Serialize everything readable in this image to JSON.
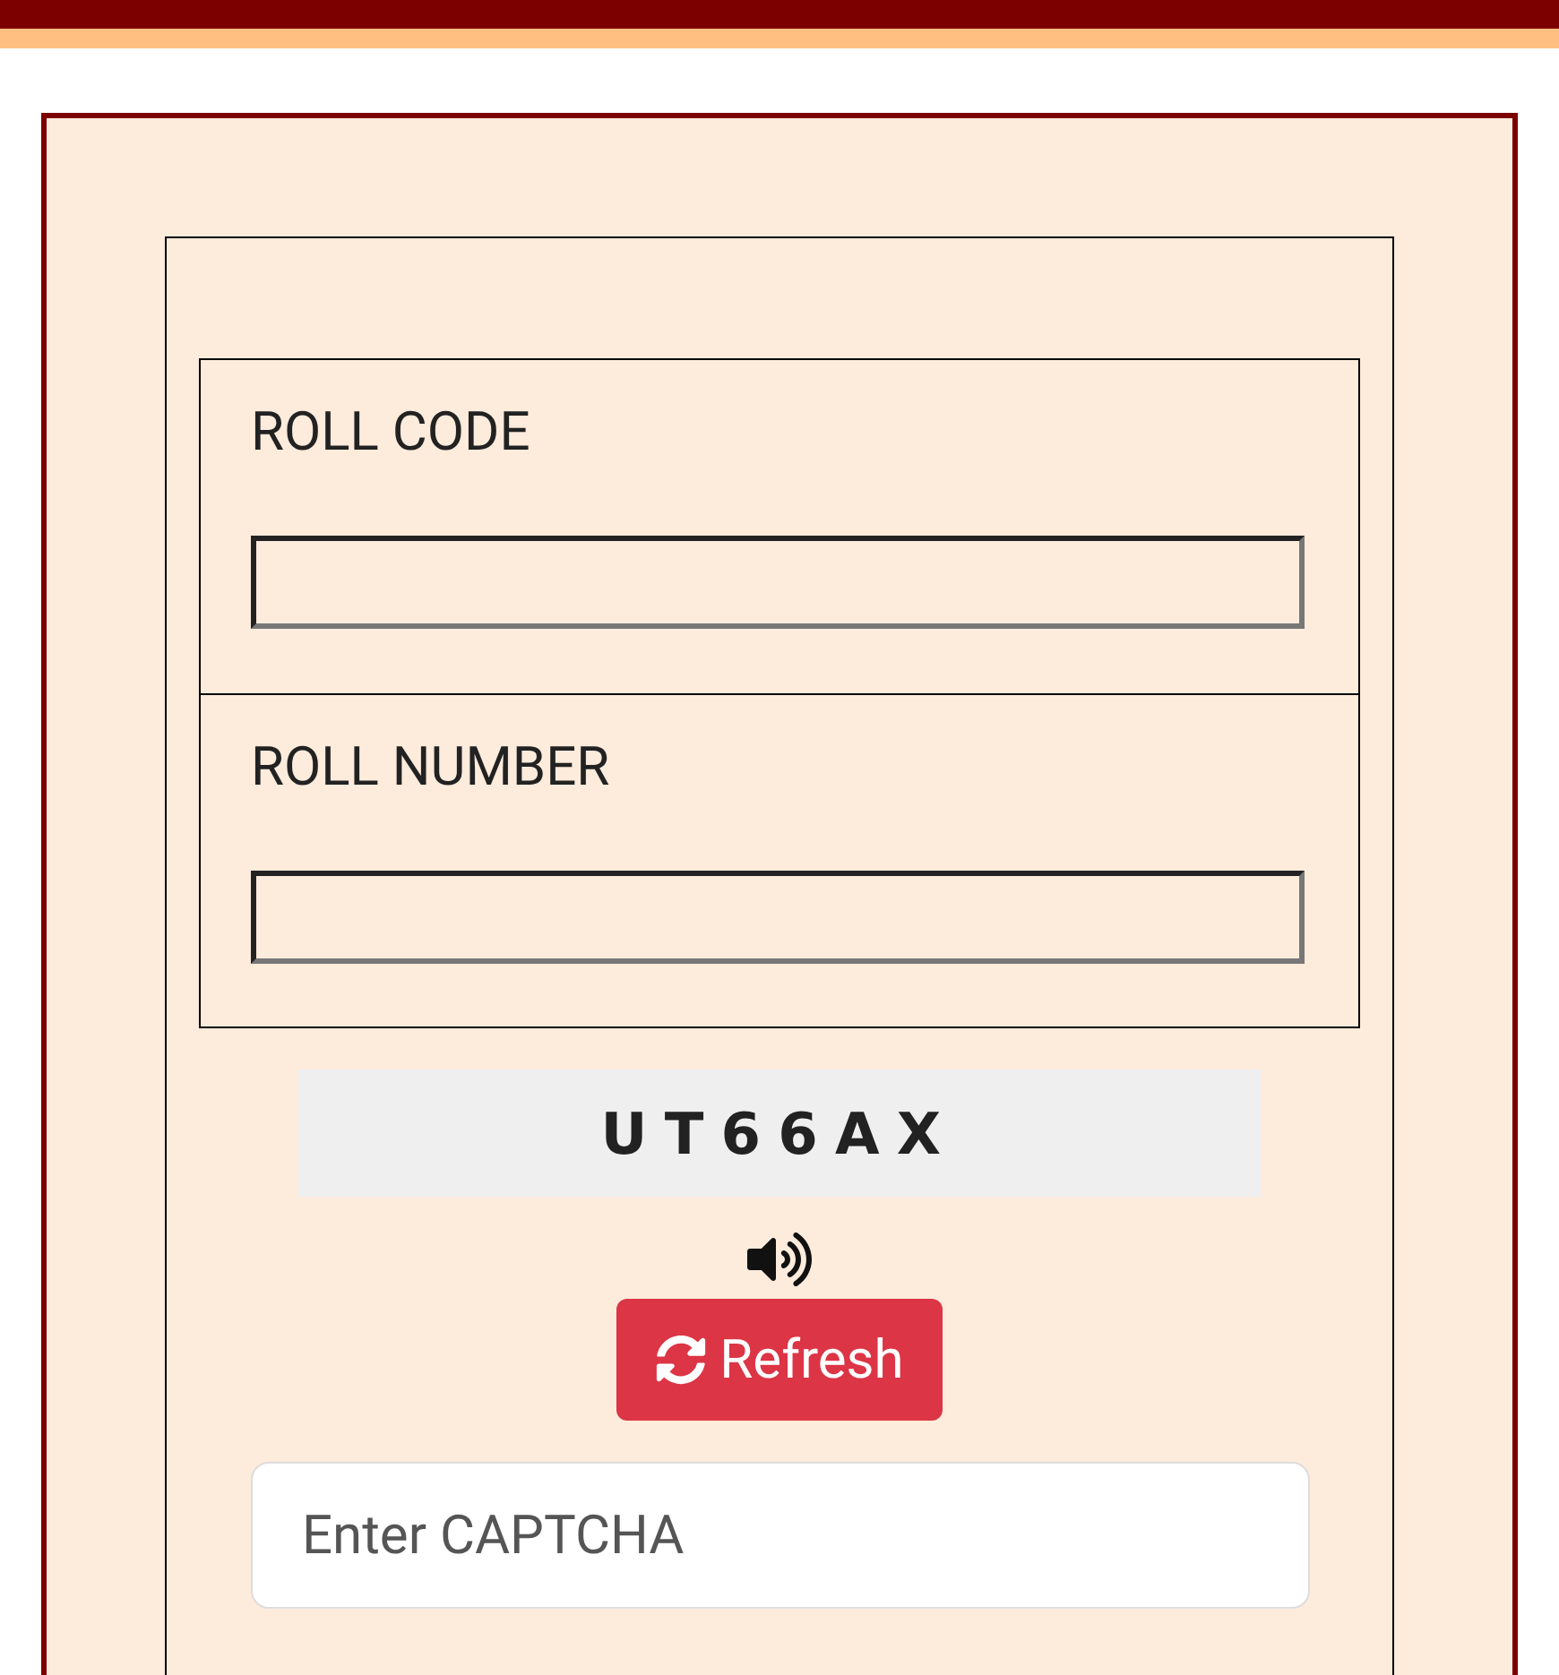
{
  "fields": [
    {
      "label": "ROLL CODE"
    },
    {
      "label": "ROLL NUMBER"
    }
  ],
  "captcha": {
    "code": "UT66AX"
  },
  "refresh_button": {
    "label": "Refresh"
  },
  "captcha_input": {
    "placeholder": "Enter CAPTCHA"
  }
}
